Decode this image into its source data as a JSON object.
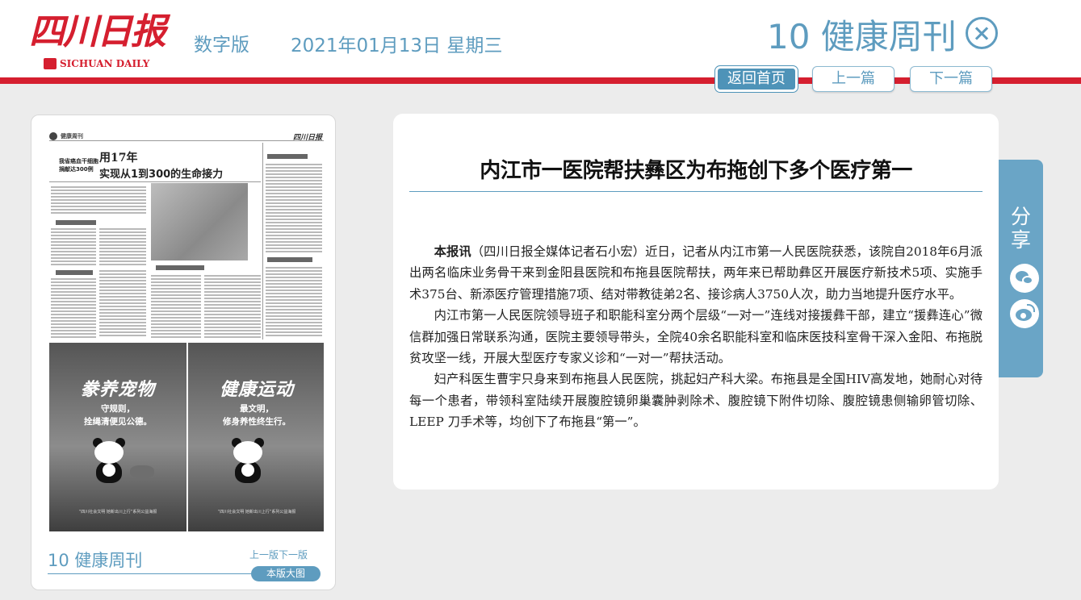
{
  "header": {
    "logo_text": "四川日报",
    "logo_en": "SICHUAN DAILY",
    "edition": "数字版",
    "date": "2021年01月13日 星期三",
    "section_title": "10 健康周刊",
    "close_icon": "close-circle-icon"
  },
  "nav": {
    "home": "返回首页",
    "prev": "上一篇",
    "next": "下一篇"
  },
  "thumbnail": {
    "page_head_section": "健康周刊",
    "page_head_logo": "四川日报",
    "kicker": "我省癌血干细胞捐献达300例",
    "headline_a": "用17年",
    "headline_b": "实现从1到300的生命接力",
    "ad_left_big": "豢养宠物",
    "ad_left_small": [
      "守规则，",
      "拴绳清便见公德。"
    ],
    "ad_right_big": "健康运动",
    "ad_right_small": [
      "最文明，",
      "修身养性终生行。"
    ],
    "ad_footer": "“四川社会文明 她新出川上行”系列公益海报",
    "title": "10 健康周刊",
    "prev_page": "上一版",
    "next_page": "下一版",
    "big_image": "本版大图"
  },
  "article": {
    "title": "内江市一医院帮扶彝区为布拖创下多个医疗第一",
    "lead": "本报讯",
    "paragraph1": "（四川日报全媒体记者石小宏）近日，记者从内江市第一人民医院获悉，该院自2018年6月派出两名临床业务骨干来到金阳县医院和布拖县医院帮扶，两年来已帮助彝区开展医疗新技术5项、实施手术375台、新添医疗管理措施7项、结对带教徒弟2名、接诊病人3750人次，助力当地提升医疗水平。",
    "paragraph2": "内江市第一人民医院领导班子和职能科室分两个层级“一对一”连线对接援彝干部，建立“援彝连心”微信群加强日常联系沟通，医院主要领导带头，全院40余名职能科室和临床医技科室骨干深入金阳、布拖脱贫攻坚一线，开展大型医疗专家义诊和“一对一”帮扶活动。",
    "paragraph3": "妇产科医生曹宇只身来到布拖县人民医院，挑起妇产科大梁。布拖县是全国HIV高发地，她耐心对待每一个患者，带领科室陆续开展腹腔镜卵巢囊肿剥除术、腹腔镜下附件切除、腹腔镜患侧输卵管切除、LEEP 刀手术等，均创下了布拖县“第一”。"
  },
  "share": {
    "label": "分享",
    "icons": [
      "wechat-icon",
      "weibo-icon"
    ]
  },
  "colors": {
    "brand_red": "#d51f2f",
    "accent_blue": "#5e9cbf",
    "share_blue": "#6aa5c6"
  }
}
